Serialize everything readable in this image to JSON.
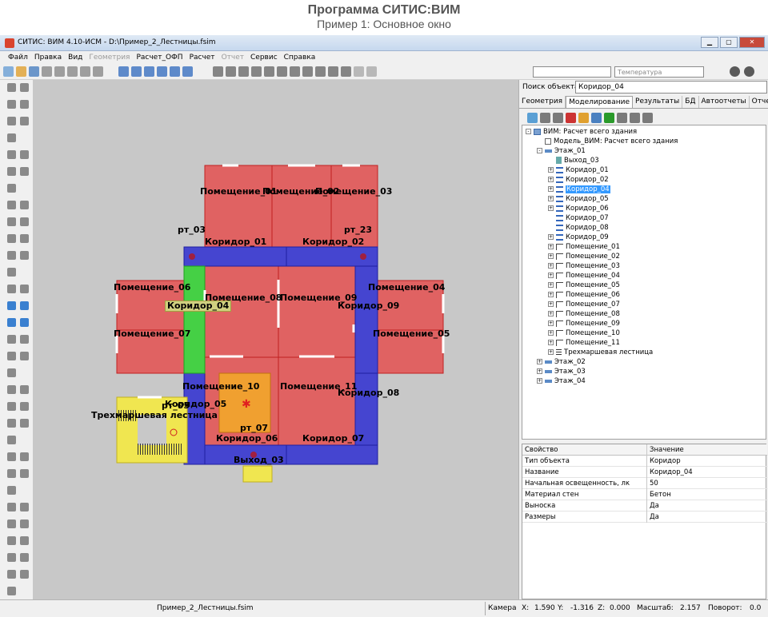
{
  "header": {
    "title": "Программа СИТИС:ВИМ",
    "subtitle": "Пример 1: Основное окно"
  },
  "window": {
    "title": "СИТИС: ВИМ  4.10-ИСМ - D:\\Пример_2_Лестницы.fsim"
  },
  "menu": [
    "Файл",
    "Правка",
    "Вид",
    "Геометрия",
    "Расчет_ОФП",
    "Расчет",
    "Отчет",
    "Сервис",
    "Справка"
  ],
  "menu_disabled": [
    "Геометрия",
    "Отчет"
  ],
  "toolbar": {
    "param_placeholder": "Температура"
  },
  "right": {
    "search_label": "Поиск объекта",
    "search_value": "Коридор_04",
    "tabs": [
      "Геометрия",
      "Моделирование",
      "Результаты",
      "БД",
      "Автоотчеты",
      "Отчеть"
    ],
    "active_tab": "Моделирование"
  },
  "tree": [
    {
      "text": "ВИМ: Расчет всего здания",
      "level": 0,
      "icon": "root",
      "exp": "-"
    },
    {
      "text": "Модель_ВИМ: Расчет всего здания",
      "level": 1,
      "icon": "model",
      "exp": ""
    },
    {
      "text": "Этаж_01",
      "level": 1,
      "icon": "floor",
      "exp": "-"
    },
    {
      "text": "Выход_03",
      "level": 2,
      "icon": "exit",
      "exp": ""
    },
    {
      "text": "Коридор_01",
      "level": 2,
      "icon": "corr",
      "exp": "+"
    },
    {
      "text": "Коридор_02",
      "level": 2,
      "icon": "corr",
      "exp": "+"
    },
    {
      "text": "Коридор_04",
      "level": 2,
      "icon": "corr",
      "exp": "+",
      "selected": true
    },
    {
      "text": "Коридор_05",
      "level": 2,
      "icon": "corr",
      "exp": "+"
    },
    {
      "text": "Коридор_06",
      "level": 2,
      "icon": "corr",
      "exp": "+"
    },
    {
      "text": "Коридор_07",
      "level": 2,
      "icon": "corr",
      "exp": ""
    },
    {
      "text": "Коридор_08",
      "level": 2,
      "icon": "corr",
      "exp": ""
    },
    {
      "text": "Коридор_09",
      "level": 2,
      "icon": "corr",
      "exp": "+"
    },
    {
      "text": "Помещение_01",
      "level": 2,
      "icon": "room",
      "exp": "+"
    },
    {
      "text": "Помещение_02",
      "level": 2,
      "icon": "room",
      "exp": "+"
    },
    {
      "text": "Помещение_03",
      "level": 2,
      "icon": "room",
      "exp": "+"
    },
    {
      "text": "Помещение_04",
      "level": 2,
      "icon": "room",
      "exp": "+"
    },
    {
      "text": "Помещение_05",
      "level": 2,
      "icon": "room",
      "exp": "+"
    },
    {
      "text": "Помещение_06",
      "level": 2,
      "icon": "room",
      "exp": "+"
    },
    {
      "text": "Помещение_07",
      "level": 2,
      "icon": "room",
      "exp": "+"
    },
    {
      "text": "Помещение_08",
      "level": 2,
      "icon": "room",
      "exp": "+"
    },
    {
      "text": "Помещение_09",
      "level": 2,
      "icon": "room",
      "exp": "+"
    },
    {
      "text": "Помещение_10",
      "level": 2,
      "icon": "room",
      "exp": "+"
    },
    {
      "text": "Помещение_11",
      "level": 2,
      "icon": "room",
      "exp": "+"
    },
    {
      "text": "Трехмаршевая лестница",
      "level": 2,
      "icon": "stair",
      "exp": "+"
    },
    {
      "text": "Этаж_02",
      "level": 1,
      "icon": "floor",
      "exp": "+"
    },
    {
      "text": "Этаж_03",
      "level": 1,
      "icon": "floor",
      "exp": "+"
    },
    {
      "text": "Этаж_04",
      "level": 1,
      "icon": "floor",
      "exp": "+"
    }
  ],
  "props": {
    "head": [
      "Свойство",
      "Значение"
    ],
    "rows": [
      [
        "Тип объекта",
        "Коридор"
      ],
      [
        "Название",
        "Коридор_04"
      ],
      [
        "Начальная освещенность, лк",
        "50"
      ],
      [
        "Материал стен",
        "Бетон"
      ],
      [
        "Выноска",
        "Да"
      ],
      [
        "Размеры",
        "Да"
      ]
    ]
  },
  "canvas_labels": [
    "Помещение_01",
    "Помещение_02",
    "Помещение_03",
    "рт_03",
    "рт_23",
    "Коридор_01",
    "Коридор_02",
    "Помещение_06",
    "Помещение_04",
    "Коридор_04",
    "Помещение_08",
    "Помещение_09",
    "Коридор_09",
    "Помещение_07",
    "Помещение_05",
    "Помещение_10",
    "Трехмаршевая лестница",
    "Помещение_11",
    "Коридор_08",
    "Коридор_05",
    "рт_07",
    "Коридор_06",
    "Коридор_07",
    "Выход_03",
    "рт_05"
  ],
  "status": {
    "file": "Пример_2_Лестницы.fsim",
    "camera": "Камера",
    "x_label": "X:",
    "x": "1.590",
    "y_label": "Y:",
    "y": "-1.316",
    "z_label": "Z:",
    "z": "0.000",
    "scale_label": "Масштаб:",
    "scale": "2.157",
    "rot_label": "Поворот:",
    "rot": "0.0"
  },
  "colors": {
    "room": "#e06262",
    "corridor": "#4545d0",
    "selected": "#45d045",
    "stair": "#f0e650",
    "hazard": "#f0a030"
  }
}
